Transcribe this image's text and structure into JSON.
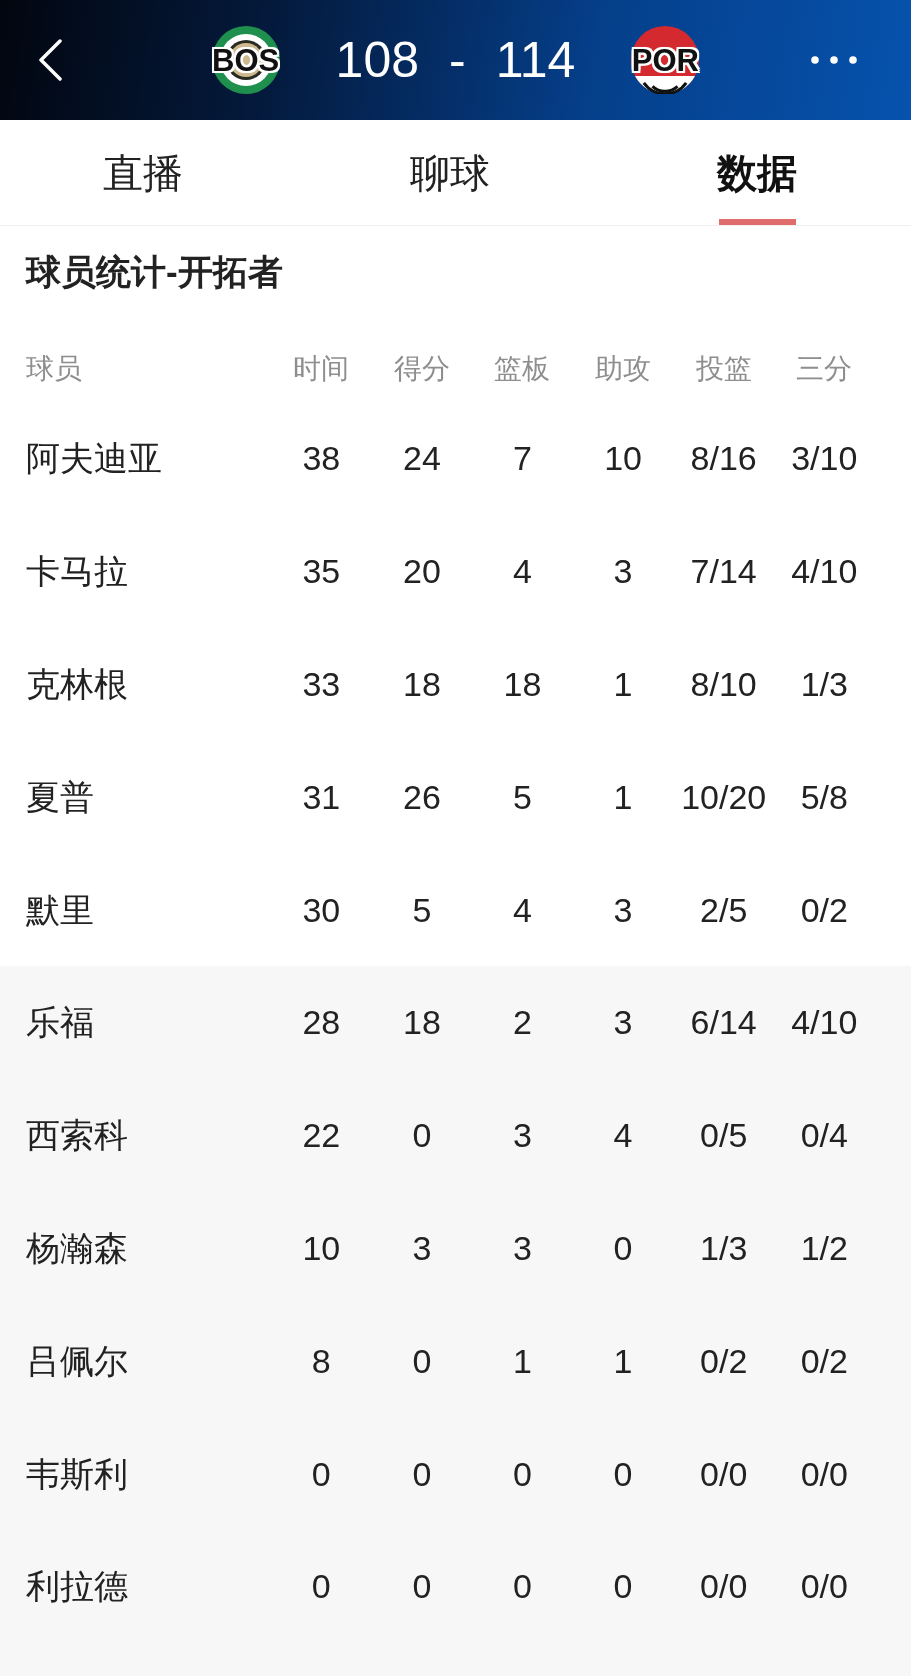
{
  "scoreboard": {
    "teams": [
      {
        "abbr": "BOS",
        "score": "108",
        "color": "#1f8f4e",
        "kind": "ring"
      },
      {
        "abbr": "POR",
        "score": "114",
        "color": "#d42a2f",
        "kind": "pinwheel"
      }
    ],
    "separator": "-"
  },
  "tabs": [
    {
      "label": "直播",
      "selected": false
    },
    {
      "label": "聊球",
      "selected": false
    },
    {
      "label": "数据",
      "selected": true
    }
  ],
  "section_title": "球员统计-开拓者",
  "table": {
    "columns": [
      "球员",
      "时间",
      "得分",
      "篮板",
      "助攻",
      "投篮",
      "三分"
    ],
    "groups": [
      {
        "kind": "starters",
        "rows": [
          [
            "阿夫迪亚",
            "38",
            "24",
            "7",
            "10",
            "8/16",
            "3/10"
          ],
          [
            "卡马拉",
            "35",
            "20",
            "4",
            "3",
            "7/14",
            "4/10"
          ],
          [
            "克林根",
            "33",
            "18",
            "18",
            "1",
            "8/10",
            "1/3"
          ],
          [
            "夏普",
            "31",
            "26",
            "5",
            "1",
            "10/20",
            "5/8"
          ],
          [
            "默里",
            "30",
            "5",
            "4",
            "3",
            "2/5",
            "0/2"
          ]
        ]
      },
      {
        "kind": "bench",
        "rows": [
          [
            "乐福",
            "28",
            "18",
            "2",
            "3",
            "6/14",
            "4/10"
          ],
          [
            "西索科",
            "22",
            "0",
            "3",
            "4",
            "0/5",
            "0/4"
          ],
          [
            "杨瀚森",
            "10",
            "3",
            "3",
            "0",
            "1/3",
            "1/2"
          ],
          [
            "吕佩尔",
            "8",
            "0",
            "1",
            "1",
            "0/2",
            "0/2"
          ],
          [
            "韦斯利",
            "0",
            "0",
            "0",
            "0",
            "0/0",
            "0/0"
          ],
          [
            "利拉德",
            "0",
            "0",
            "0",
            "0",
            "0/0",
            "0/0"
          ]
        ]
      }
    ]
  }
}
